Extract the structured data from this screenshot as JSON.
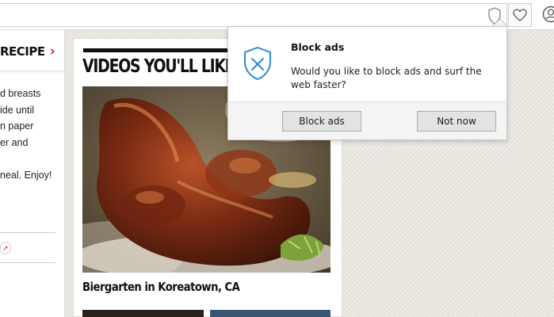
{
  "browser": {
    "address_icon": "adblock-icon",
    "favorites_icon": "heart-icon",
    "profile_icon": "profile-icon"
  },
  "left_column": {
    "tab_label": "RECIPE",
    "tab_chevron": "›",
    "recipe_text": "d breasts\nide until\nn paper\ner and\n\nneal. Enjoy!",
    "pin_icon": "pin-icon",
    "accent_color": "#d4202b"
  },
  "videos": {
    "heading": "VIDEOS YOU'LL LIKE",
    "featured_caption": "Biergarten in Koreatown, CA",
    "thumbnail_icon": "roast-chicken-image"
  },
  "popup": {
    "icon": "shield-icon",
    "title": "Block ads",
    "message": "Would you like to block ads and surf the web faster?",
    "block_button": "Block ads",
    "not_now_button": "Not now",
    "shield_color": "#2b8ad8"
  }
}
